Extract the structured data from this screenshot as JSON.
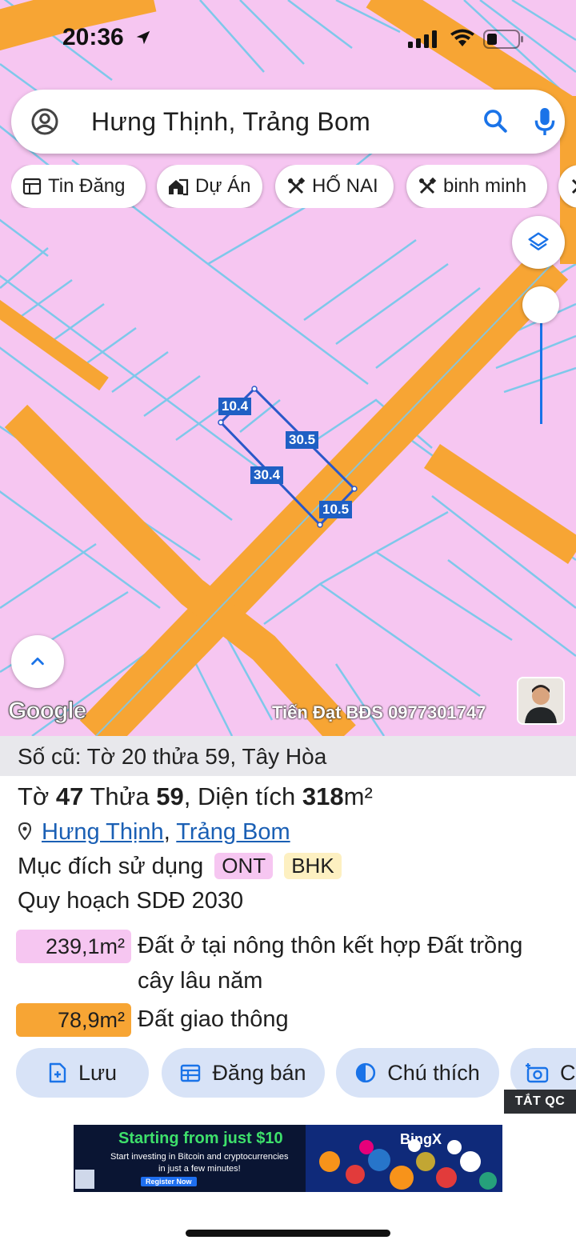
{
  "status_bar": {
    "time": "20:36"
  },
  "search": {
    "query": "Hưng Thịnh, Trảng Bom"
  },
  "chips": [
    {
      "label": "Tin Đăng",
      "icon": "newspaper-icon"
    },
    {
      "label": "Dự Án",
      "icon": "house-icon"
    },
    {
      "label": "HỐ NAI",
      "icon": "tools-icon"
    },
    {
      "label": "binh minh",
      "icon": "tools-icon"
    }
  ],
  "map": {
    "dimensions": [
      "10.4",
      "30.5",
      "30.4",
      "10.5"
    ],
    "attribution": "Google",
    "watermark": "Tiến Đạt BĐS 0977301747",
    "colors": {
      "land": "#f6c6f1",
      "road": "#f7a534",
      "parcel_lines": "#7ec8ea",
      "selection": "#2a58c9"
    }
  },
  "parcel": {
    "old_number": "Số cũ: Tờ 20 thửa 59, Tây Hòa",
    "title_prefix_sheet": "Tờ",
    "sheet": "47",
    "title_prefix_lot": "Thửa",
    "lot": "59",
    "title_area_label": ", Diện tích",
    "area": "318",
    "area_unit": "m²",
    "commune": "Hưng Thịnh",
    "district": "Trảng Bom",
    "purpose_label": "Mục đích sử dụng",
    "purpose_tags": [
      "ONT",
      "BHK"
    ],
    "plan_label": "Quy hoạch SDĐ 2030",
    "plan_items": [
      {
        "area": "239,1m²",
        "line1": "Đất ở tại nông thôn kết hợp Đất trồng",
        "line2": "cây lâu năm",
        "color": "#f6c6f1"
      },
      {
        "area": "78,9m²",
        "line1": "Đất giao thông",
        "line2": "",
        "color": "#f7a534"
      }
    ]
  },
  "actions": [
    {
      "label": "Lưu",
      "icon": "add-file-icon"
    },
    {
      "label": "Đăng bán",
      "icon": "calendar-icon"
    },
    {
      "label": "Chú thích",
      "icon": "contrast-icon"
    },
    {
      "label": "C",
      "icon": "camera-icon"
    }
  ],
  "ad": {
    "close_label": "TẮT QC",
    "headline": "Starting from just $10",
    "line1": "Start investing in Bitcoin and cryptocurrencies",
    "line2": "in just a few minutes!",
    "cta": "Register Now",
    "brand": "BingX"
  }
}
